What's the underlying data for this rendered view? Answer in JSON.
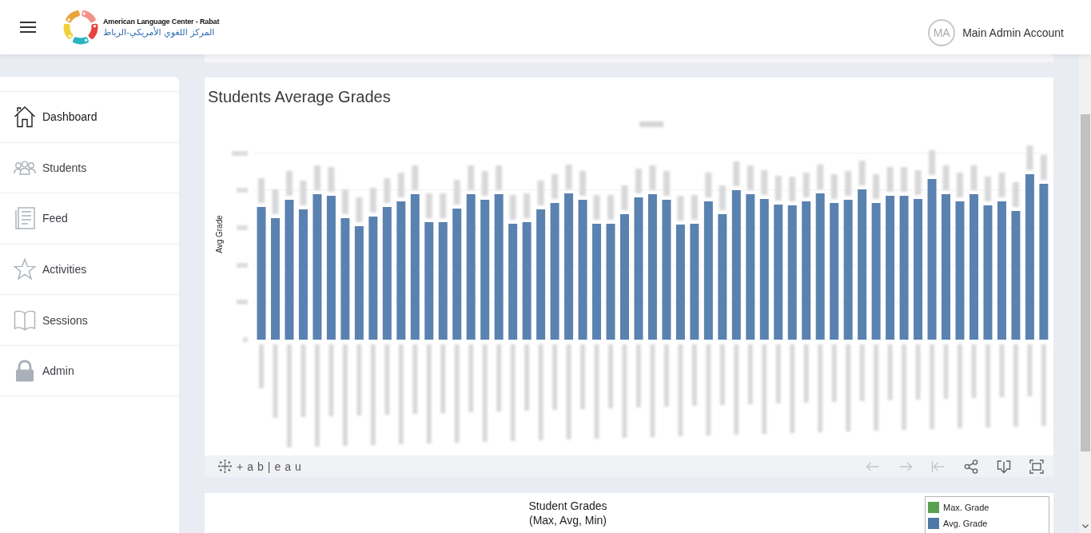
{
  "header": {
    "brand": {
      "name_en": "American Language Center - Rabat",
      "name_ar": "المركز اللغوي الأمريكي-الرباط"
    },
    "user": {
      "initials": "MA",
      "name": "Main Admin Account"
    }
  },
  "sidebar": {
    "items": [
      {
        "label": "Dashboard",
        "selected": true
      },
      {
        "label": "Students",
        "selected": false
      },
      {
        "label": "Feed",
        "selected": false
      },
      {
        "label": "Activities",
        "selected": false
      },
      {
        "label": "Sessions",
        "selected": false
      },
      {
        "label": "Admin",
        "selected": false
      }
    ]
  },
  "dashboard": {
    "title": "Students Average Grades",
    "chart": {
      "y_axis_title": "Avg Grade"
    },
    "toolbar": {
      "logo_text": "+ab|eau",
      "buttons": [
        {
          "kind": "undo",
          "disabled": true
        },
        {
          "kind": "redo",
          "disabled": true
        },
        {
          "kind": "revert",
          "disabled": true
        },
        {
          "kind": "share",
          "disabled": false
        },
        {
          "kind": "download",
          "disabled": false
        },
        {
          "kind": "fullscreen",
          "disabled": false
        }
      ]
    }
  },
  "grades_panel": {
    "title": "Student Grades",
    "subtitle": "(Max, Avg, Min)",
    "legend": [
      {
        "label": "Max. Grade",
        "color": "#59a14f"
      },
      {
        "label": "Avg. Grade",
        "color": "#4e79a7"
      }
    ]
  }
}
